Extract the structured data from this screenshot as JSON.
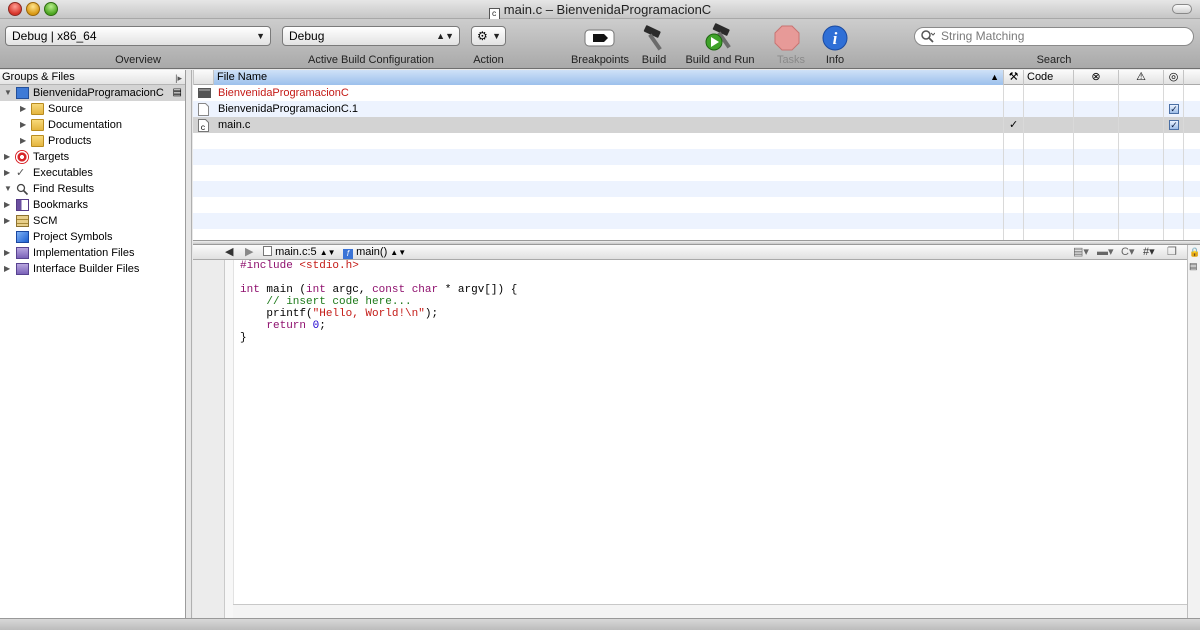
{
  "window": {
    "title": "main.c – BienvenidaProgramacionC",
    "doc_icon_glyph": "c"
  },
  "toolbar": {
    "overview_value": "Debug | x86_64",
    "overview_label": "Overview",
    "config_value": "Debug",
    "config_label": "Active Build Configuration",
    "action_label": "Action",
    "breakpoints_label": "Breakpoints",
    "build_label": "Build",
    "build_run_label": "Build and Run",
    "tasks_label": "Tasks",
    "info_label": "Info",
    "search_placeholder": "String Matching",
    "search_label": "Search"
  },
  "sidebar": {
    "header": "Groups & Files",
    "items": [
      {
        "label": "BienvenidaProgramacionC",
        "icon": "project-icon"
      },
      {
        "label": "Source",
        "icon": "folder-icon"
      },
      {
        "label": "Documentation",
        "icon": "folder-icon"
      },
      {
        "label": "Products",
        "icon": "folder-icon"
      },
      {
        "label": "Targets",
        "icon": "target-icon"
      },
      {
        "label": "Executables",
        "icon": "executables-icon"
      },
      {
        "label": "Find Results",
        "icon": "magnifier-icon"
      },
      {
        "label": "Bookmarks",
        "icon": "bookmarks-icon"
      },
      {
        "label": "SCM",
        "icon": "scm-icon"
      },
      {
        "label": "Project Symbols",
        "icon": "cube-icon"
      },
      {
        "label": "Implementation Files",
        "icon": "smart-group-icon"
      },
      {
        "label": "Interface Builder Files",
        "icon": "smart-group-icon"
      }
    ]
  },
  "file_list": {
    "columns": {
      "file_name": "File Name",
      "code": "Code"
    },
    "rows": [
      {
        "name": "BienvenidaProgramacionC",
        "color": "#c41a16",
        "icon": "executable-icon",
        "check": "",
        "checked": false
      },
      {
        "name": "BienvenidaProgramacionC.1",
        "color": "#000000",
        "icon": "document-icon",
        "check": "",
        "checked": true
      },
      {
        "name": "main.c",
        "color": "#000000",
        "icon": "c-file-icon",
        "check": "✓",
        "checked": true
      }
    ]
  },
  "editor": {
    "nav_file": "main.c:5",
    "nav_func": "main()",
    "code_lines": [
      "#include <stdio.h>",
      "",
      "int main (int argc, const char * argv[]) {",
      "    // insert code here...",
      "    printf(\"Hello, World!\\n\");",
      "    return 0;",
      "}"
    ]
  }
}
